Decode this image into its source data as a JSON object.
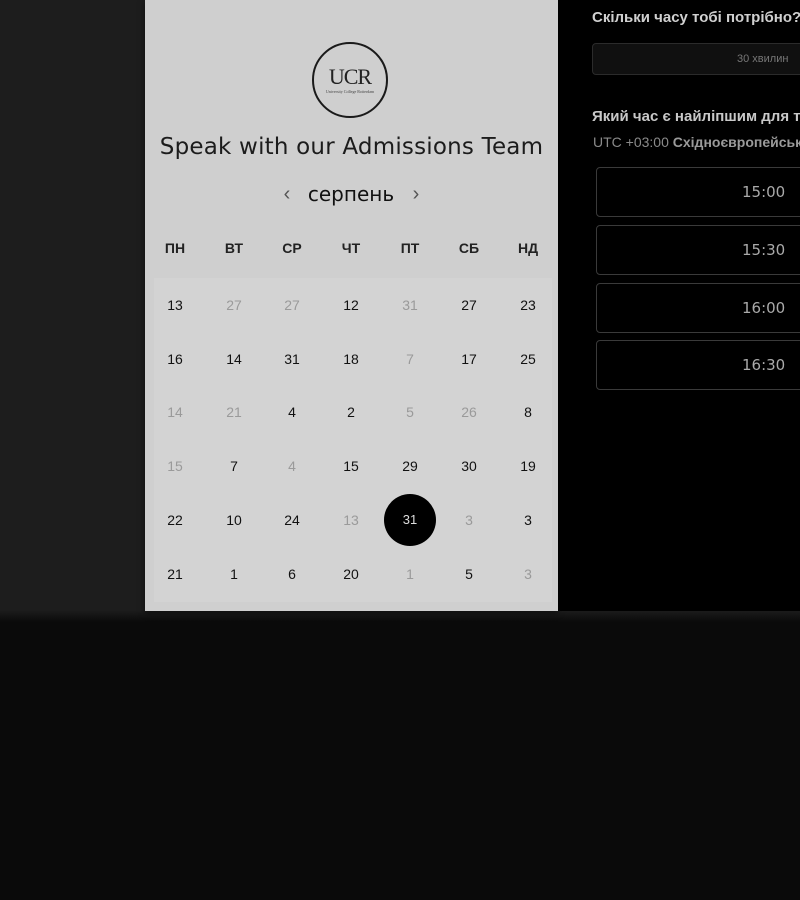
{
  "branding": {
    "logo_text": "UCR",
    "logo_subtext": "University College Rotterdam"
  },
  "calendar": {
    "title": "Speak with our Admissions Team",
    "month": "серпень",
    "prev_icon": "‹",
    "next_icon": "›",
    "weekdays": [
      "ПН",
      "ВТ",
      "СР",
      "ЧТ",
      "ПТ",
      "СБ",
      "НД"
    ],
    "weeks": [
      [
        {
          "d": "13",
          "m": false
        },
        {
          "d": "27",
          "m": true
        },
        {
          "d": "27",
          "m": true
        },
        {
          "d": "12",
          "m": false
        },
        {
          "d": "31",
          "m": true
        },
        {
          "d": "27",
          "m": false
        },
        {
          "d": "23",
          "m": false
        }
      ],
      [
        {
          "d": "16",
          "m": false
        },
        {
          "d": "14",
          "m": false
        },
        {
          "d": "31",
          "m": false
        },
        {
          "d": "18",
          "m": false
        },
        {
          "d": "7",
          "m": true
        },
        {
          "d": "17",
          "m": false
        },
        {
          "d": "25",
          "m": false
        }
      ],
      [
        {
          "d": "14",
          "m": true
        },
        {
          "d": "21",
          "m": true
        },
        {
          "d": "4",
          "m": false
        },
        {
          "d": "2",
          "m": false
        },
        {
          "d": "5",
          "m": true
        },
        {
          "d": "26",
          "m": true
        },
        {
          "d": "8",
          "m": false
        }
      ],
      [
        {
          "d": "15",
          "m": true
        },
        {
          "d": "7",
          "m": false
        },
        {
          "d": "4",
          "m": true
        },
        {
          "d": "15",
          "m": false
        },
        {
          "d": "29",
          "m": false
        },
        {
          "d": "30",
          "m": false
        },
        {
          "d": "19",
          "m": false
        }
      ],
      [
        {
          "d": "22",
          "m": false
        },
        {
          "d": "10",
          "m": false
        },
        {
          "d": "24",
          "m": false
        },
        {
          "d": "13",
          "m": true
        },
        {
          "d": "31",
          "m": false,
          "selected": true
        },
        {
          "d": "3",
          "m": true
        },
        {
          "d": "3",
          "m": false
        }
      ],
      [
        {
          "d": "21",
          "m": false
        },
        {
          "d": "1",
          "m": false
        },
        {
          "d": "6",
          "m": false
        },
        {
          "d": "20",
          "m": false
        },
        {
          "d": "1",
          "m": true
        },
        {
          "d": "5",
          "m": false
        },
        {
          "d": "3",
          "m": true
        }
      ]
    ]
  },
  "booking": {
    "duration_question": "Скільки часу тобі потрібно?",
    "duration_value": "30 хвилин",
    "time_question": "Який час є найліпшим для тебе?",
    "timezone_offset": "UTC +03:00",
    "timezone_name": "Східноєвропейський час",
    "slots": [
      "15:00",
      "15:30",
      "16:00",
      "16:30"
    ]
  }
}
